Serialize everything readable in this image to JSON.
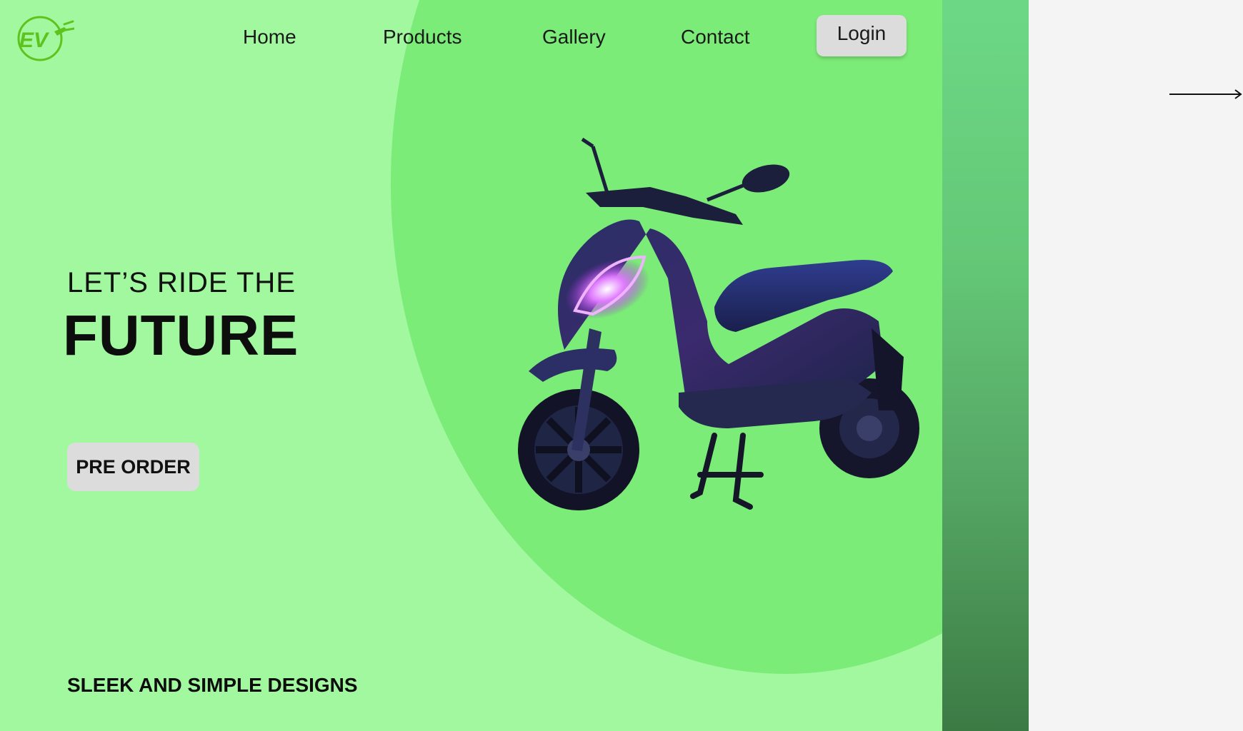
{
  "brand": {
    "logo_text": "EV",
    "colors": {
      "logo": "#5ec41d",
      "hero_bg": "#a2f89f",
      "hero_blob": "#7bec77",
      "strip_top": "#6cd885",
      "strip_bottom": "#3c7a44",
      "panel_bg": "#f4f4f4"
    }
  },
  "nav": {
    "items": [
      {
        "label": "Home"
      },
      {
        "label": "Products"
      },
      {
        "label": "Gallery"
      },
      {
        "label": "Contact"
      }
    ],
    "login_label": "Login"
  },
  "hero": {
    "subtitle": "LET’S RIDE THE",
    "title": "FUTURE",
    "cta_label": "PRE ORDER",
    "image_icon": "scooter-image"
  },
  "section": {
    "heading": "SLEEK AND SIMPLE DESIGNS"
  },
  "side": {
    "arrow_icon": "arrow-right-icon"
  }
}
